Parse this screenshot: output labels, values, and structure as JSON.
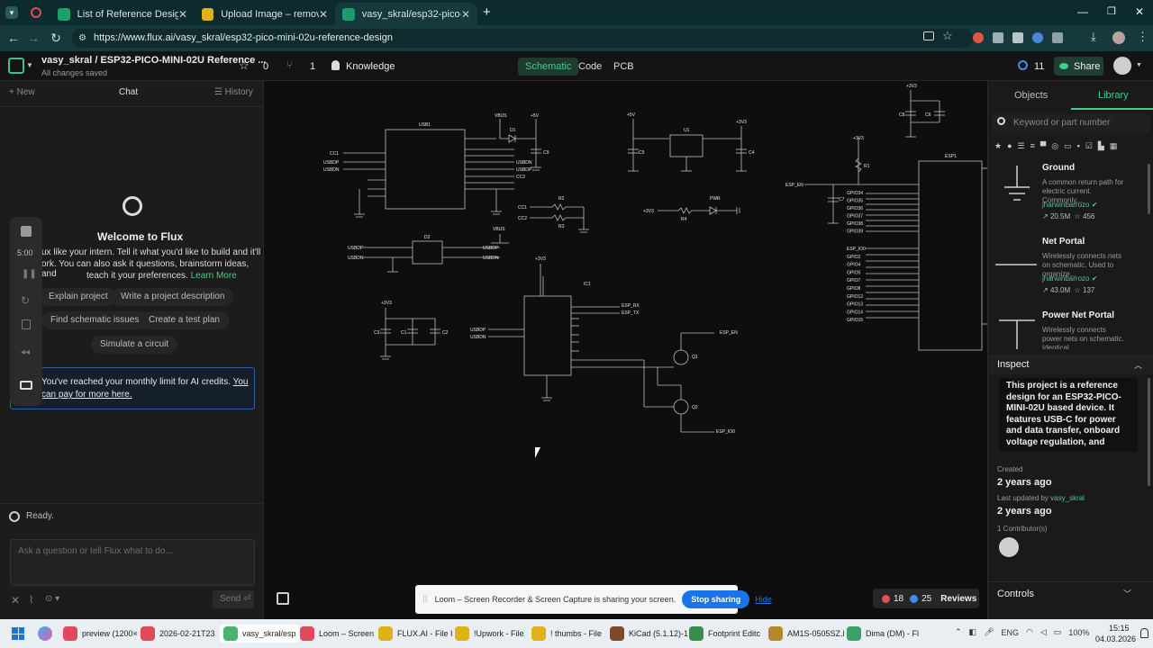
{
  "browser": {
    "tabs": [
      {
        "label": "List of Reference Design(vasy_sk",
        "color": "#1aa16a"
      },
      {
        "label": "Upload Image – remove.bg",
        "color": "#e0b21a"
      },
      {
        "label": "vasy_skral/esp32-pico-mini-02u",
        "color": "#1d9b6e"
      }
    ],
    "url": "https://www.flux.ai/vasy_skral/esp32-pico-mini-02u-reference-design"
  },
  "header": {
    "project_title": "vasy_skral / ESP32-PICO-MINI-02U Reference ...",
    "save_status": "All changes saved",
    "stars": "0",
    "forks": "1",
    "knowledge": "Knowledge",
    "tabs": [
      "Schematic",
      "Code",
      "PCB"
    ],
    "sync_count": "11",
    "share": "Share"
  },
  "chat": {
    "new": "New",
    "title": "Chat",
    "history": "History",
    "welcome_title": "Welcome to Flux",
    "welcome_body_1": "ux like your intern. Tell it what you'd like to build and it'll",
    "welcome_body_2": "ork. You can also ask it questions, brainstorm ideas, and",
    "welcome_body_3": "teach it your preferences.",
    "learn_more": "Learn More",
    "suggestions": [
      "Explain project",
      "Write a project description",
      "Find schematic issues",
      "Create a test plan",
      "Simulate a circuit"
    ],
    "limit_1": "You've reached your monthly limit for AI credits.",
    "limit_link_1": "You",
    "limit_2": "can pay for more here.",
    "status": "Ready.",
    "input_placeholder": "Ask a question or tell Flux what to do...",
    "send": "Send",
    "recorder_time": "5:00"
  },
  "library": {
    "tabs": [
      "Objects",
      "Library"
    ],
    "search_placeholder": "Keyword or part number",
    "items": [
      {
        "title": "Ground",
        "desc": "A common return path for electric current. Commonly...",
        "author": "jharwinbarrozo",
        "uses": "20.5M",
        "stars": "456"
      },
      {
        "title": "Net Portal",
        "desc": "Wirelessly connects nets on schematic. Used to organize...",
        "author": "jharwinbarrozo",
        "uses": "43.0M",
        "stars": "137"
      },
      {
        "title": "Power Net Portal",
        "desc": "Wirelessly connects power nets on schematic. Identical...",
        "author": "",
        "uses": "",
        "stars": ""
      }
    ],
    "inspect_label": "Inspect",
    "inspect_text": "This project is a reference design for an ESP32-PICO-MINI-02U based device. It features USB-C for power and data transfer, onboard voltage regulation, and",
    "created_label": "Created",
    "created_value": "2 years ago",
    "updated_label": "Last updated by",
    "updated_user": "vasy_skral",
    "updated_value": "2 years ago",
    "contributors": "1 Contributor(s)",
    "controls": "Controls"
  },
  "canvas": {
    "share_banner": "Loom – Screen Recorder & Screen Capture is sharing your screen.",
    "stop_sharing": "Stop sharing",
    "hide": "Hide",
    "errors": "18",
    "warnings": "25",
    "reviews": "Reviews",
    "labels": {
      "usb1": "USB1",
      "vbus": "VBUS",
      "p5v": "+5V",
      "d1": "D1",
      "c9": "C9",
      "cc1": "CC1",
      "usbdp": "USBDP",
      "usbdn": "USBDN",
      "cc2": "CC2",
      "u1": "U1",
      "c5": "C5",
      "c4": "C4",
      "p3v3": "+3V3",
      "r2": "R2",
      "r3": "R3",
      "r4": "R4",
      "r1": "R1",
      "pwr": "PWR",
      "d2": "D2",
      "ic1": "IC1",
      "esp_rx": "ESP_RX",
      "esp_tx": "ESP_TX",
      "c3": "C3",
      "c1": "C1",
      "c2": "C2",
      "esp_en": "ESP_EN",
      "q1": "Q1",
      "q2": "Q2",
      "esp_io0": "ESP_IO0",
      "c7": "C7",
      "c8": "C8",
      "c6": "C6",
      "esp1": "ESP1",
      "gpio": [
        "GPIO34",
        "GPIO35",
        "GPIO36",
        "GPIO37",
        "GPIO38",
        "GPIO39"
      ],
      "gpio2": [
        "ESP_IO0",
        "GPIO2",
        "GPIO4",
        "GPIO5",
        "GPIO7",
        "GPIO8",
        "GPIO12",
        "GPIO13",
        "GPIO14",
        "GPIO15"
      ]
    }
  },
  "taskbar": {
    "items": [
      "preview (1200×",
      "2026-02-21T23",
      "vasy_skral/esp",
      "Loom – Screen",
      "FLUX.AI - File I",
      "!Upwork - File",
      "! thumbs - File",
      "KiCad (5.1.12)-1",
      "Footprint Editc",
      "AM1S-0505SZ.l",
      "Dima (DM) - Fl"
    ],
    "lang": "ENG",
    "battery": "100%",
    "time": "15:15",
    "date": "04.03.2026"
  }
}
